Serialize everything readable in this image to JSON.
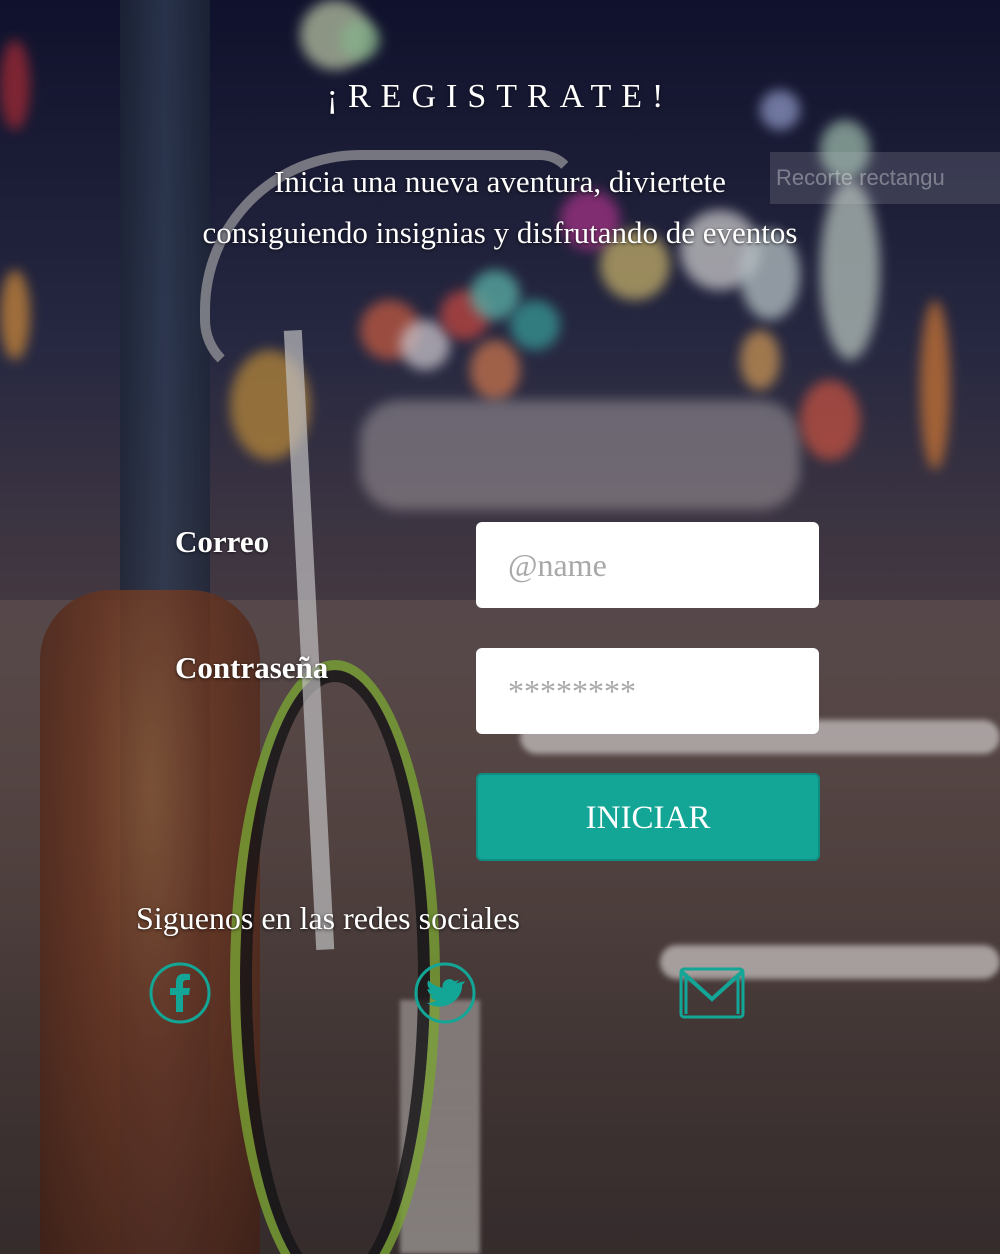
{
  "header": {
    "title": "¡REGISTRATE!",
    "subtitle": "Inicia una nueva aventura, diviertete consiguiendo insignias y disfrutando de eventos"
  },
  "overlay": {
    "ghost_text": "Recorte rectangu"
  },
  "form": {
    "email_label": "Correo",
    "email_placeholder": "@name",
    "email_value": "",
    "password_label": "Contraseña",
    "password_placeholder": "********",
    "password_value": "",
    "submit_label": "INICIAR"
  },
  "social": {
    "heading": "Siguenos en las redes sociales",
    "icons": [
      "facebook-icon",
      "twitter-icon",
      "mail-icon"
    ],
    "icon_color": "#13a696"
  },
  "colors": {
    "accent": "#13a696",
    "text": "#ffffff"
  }
}
